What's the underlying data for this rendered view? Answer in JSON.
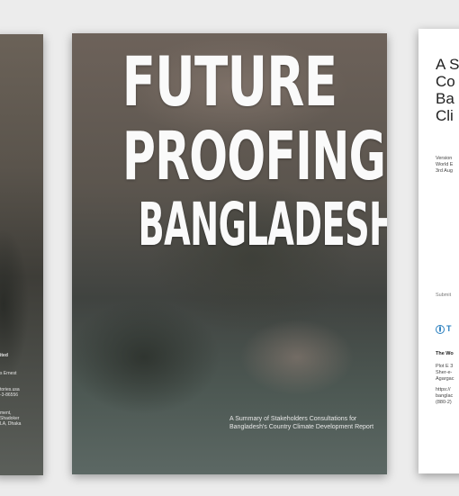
{
  "back_cover": {
    "blocks": [
      "ited",
      "s Ernest",
      "tories.usa\n-3-86556",
      "ment,\nShadoker\nLA, Dhaka"
    ]
  },
  "cover": {
    "title_line1": "FUTURE",
    "title_line2": "PROOFING",
    "title_line3": "BANGLADESH",
    "summary": "A Summary of Stakeholders Consultations for Bangladesh's Country Climate Development Report"
  },
  "report_page": {
    "title": "A S\nCo\nBa\nCli",
    "version_lines": "Version\nWorld E\n3rd Aug",
    "submitted": "Submit",
    "wb_letter": "T",
    "org": "The Wo",
    "address": "Plot E 3\nSher-e-\nAgargac",
    "contact": "https://\nbanglac\n(880-2)"
  }
}
